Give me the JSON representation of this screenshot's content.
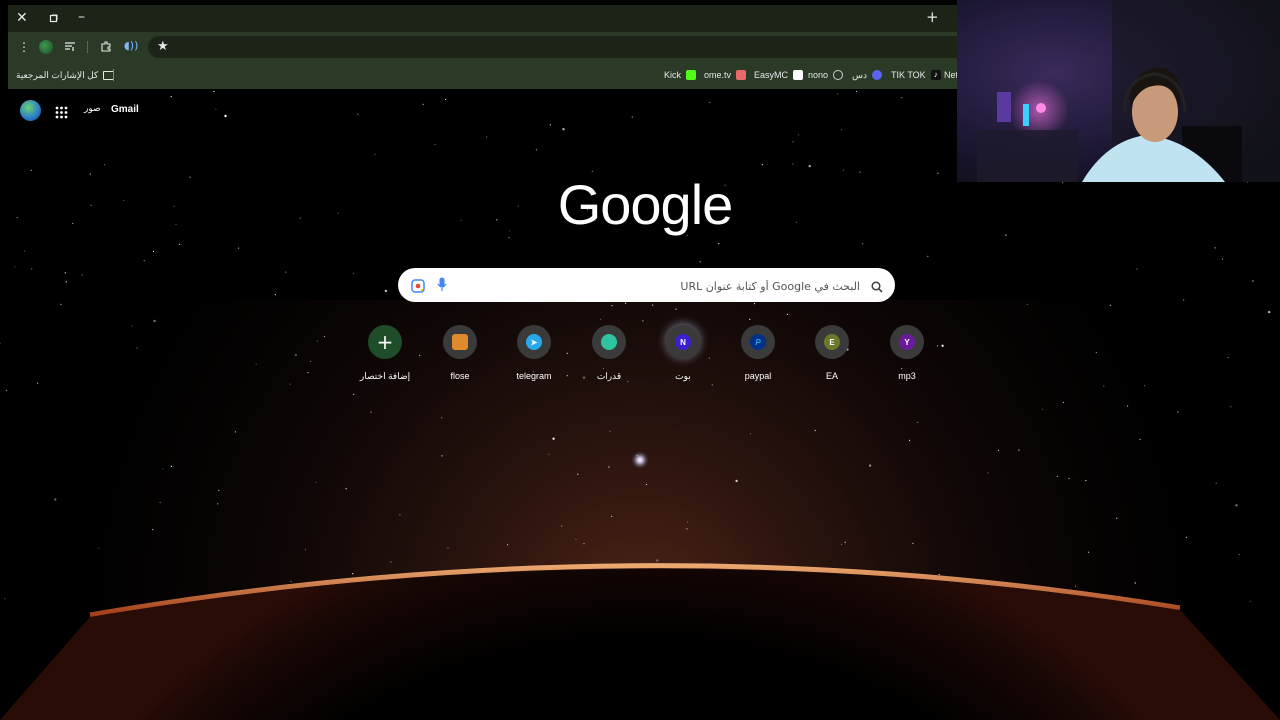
{
  "bookmarks_bar": {
    "all_bookmarks_label": "كل الإشارات المرجعية",
    "items": [
      {
        "label": "Kick",
        "icon": "kick-icon",
        "color": "#53fc18"
      },
      {
        "label": "ome.tv",
        "icon": "ometv-icon",
        "color": "#e86a6a"
      },
      {
        "label": "EasyMC",
        "icon": "easymc-icon",
        "color": "#ffffff"
      },
      {
        "label": "nono",
        "icon": "globe-icon",
        "color": "#cccccc"
      },
      {
        "label": "دس",
        "icon": "discord-icon",
        "color": "#5865f2"
      },
      {
        "label": "TIK TOK",
        "icon": "tiktok-icon",
        "color": "#ffffff"
      },
      {
        "label": "Net",
        "icon": "netflix-icon",
        "color": "#e50914"
      }
    ]
  },
  "page": {
    "gmail_label": "Gmail",
    "images_label": "صور",
    "logo_text": "Google",
    "search_placeholder": "البحث في Google أو كتابة عنوان URL"
  },
  "shortcuts": [
    {
      "label": "mp3",
      "initial": "Y",
      "color": "#6a1b9a"
    },
    {
      "label": "EA",
      "initial": "E",
      "color": "#6b7a2a"
    },
    {
      "label": "paypal",
      "initial": "P",
      "color": "#003087"
    },
    {
      "label": "بوت",
      "initial": "N",
      "color": "#3b1fd1"
    },
    {
      "label": "قدرات",
      "initial": "",
      "color": "#2ec4a0"
    },
    {
      "label": "telegram",
      "initial": "",
      "color": "#29a9eb"
    },
    {
      "label": "flose",
      "initial": "",
      "color": "#e08a2e"
    },
    {
      "label": "إضافة اختصار",
      "initial": "+",
      "color": "#1f4d2a"
    }
  ],
  "colors": {
    "titlebar": "#1b2417",
    "toolbar": "#2a3a26",
    "accent": "#7fb3ff"
  }
}
